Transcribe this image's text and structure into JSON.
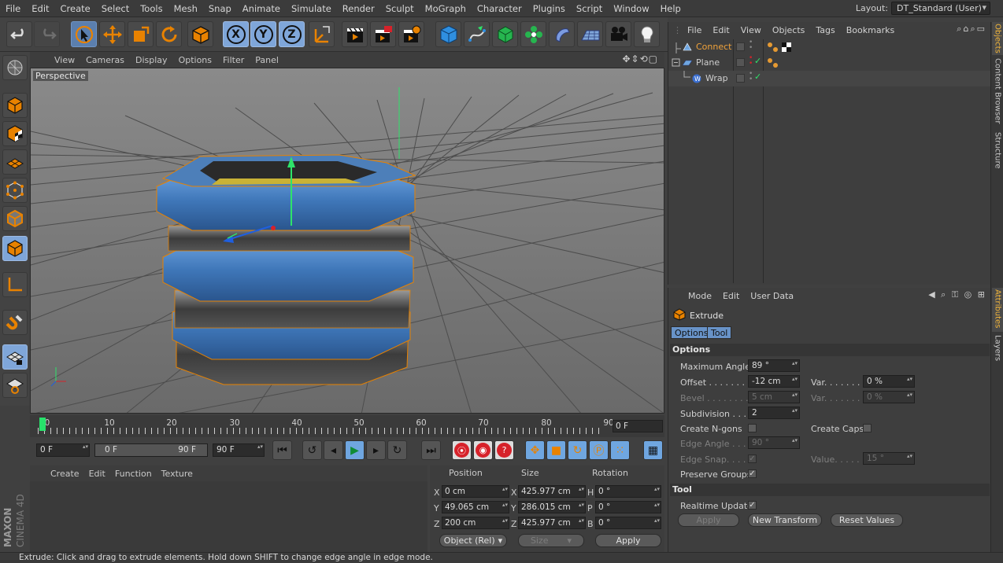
{
  "menubar": {
    "items": [
      "File",
      "Edit",
      "Create",
      "Select",
      "Tools",
      "Mesh",
      "Snap",
      "Animate",
      "Simulate",
      "Render",
      "Sculpt",
      "MoGraph",
      "Character",
      "Plugins",
      "Script",
      "Window",
      "Help"
    ],
    "layout_label": "Layout:",
    "layout_value": "DT_Standard (User)"
  },
  "toolbar": {
    "axis_x": "X",
    "axis_y": "Y",
    "axis_z": "Z"
  },
  "viewport": {
    "menu": [
      "View",
      "Cameras",
      "Display",
      "Options",
      "Filter",
      "Panel"
    ],
    "nav_icons": "✥⇕⟲▢",
    "label": "Perspective"
  },
  "timeline": {
    "ticks": [
      "0",
      "10",
      "20",
      "30",
      "40",
      "50",
      "60",
      "70",
      "80",
      "90"
    ],
    "current_frame": "0 F"
  },
  "playback": {
    "start": "0 F",
    "range_start": "0 F",
    "range_end": "90 F",
    "end": "90 F"
  },
  "material_menu": [
    "Create",
    "Edit",
    "Function",
    "Texture"
  ],
  "coordinates": {
    "headers": {
      "position": "Position",
      "size": "Size",
      "rotation": "Rotation"
    },
    "rows": [
      {
        "axis": "X",
        "pos": "0 cm",
        "size_axis": "X",
        "size": "425.977 cm",
        "rot_axis": "H",
        "rot": "0 °"
      },
      {
        "axis": "Y",
        "pos": "49.065 cm",
        "size_axis": "Y",
        "size": "286.015 cm",
        "rot_axis": "P",
        "rot": "0 °"
      },
      {
        "axis": "Z",
        "pos": "200 cm",
        "size_axis": "Z",
        "size": "425.977 cm",
        "rot_axis": "B",
        "rot": "0 °"
      }
    ],
    "mode": "Object (Rel)",
    "size_mode": "Size",
    "apply": "Apply"
  },
  "objects": {
    "menu": [
      "File",
      "Edit",
      "View",
      "Objects",
      "Tags",
      "Bookmarks"
    ],
    "icons": "⌕⌂⌕▭",
    "items": [
      {
        "name": "Connect",
        "active": true
      },
      {
        "name": "Plane",
        "active": false
      },
      {
        "name": "Wrap",
        "active": false
      }
    ]
  },
  "attributes": {
    "menu": [
      "Mode",
      "Edit",
      "User Data"
    ],
    "icons": "◀ ⌕ ⚿ ◎ ⊞",
    "title": "Extrude",
    "tabs": [
      "Options",
      "Tool"
    ],
    "section_options": "Options",
    "section_tool": "Tool",
    "fields": {
      "max_angle_label": "Maximum Angle",
      "max_angle": "89 °",
      "offset_label": "Offset . . . . . . . .",
      "offset": "-12 cm",
      "offset_var_label": "Var. . . . . . . . .",
      "offset_var": "0 %",
      "bevel_label": "Bevel . . . . . . . .",
      "bevel": "5 cm",
      "bevel_var_label": "Var. . . . . . . . .",
      "bevel_var": "0 %",
      "subdiv_label": "Subdivision . . . .",
      "subdiv": "2",
      "ngons_label": "Create N-gons",
      "caps_label": "Create Caps",
      "edge_angle_label": "Edge Angle . . . .",
      "edge_angle": "90 °",
      "edge_snap_label": "Edge Snap. . . . .",
      "edge_value_label": "Value. . . . . . . .",
      "edge_value": "15 °",
      "preserve_label": "Preserve Groups",
      "realtime_label": "Realtime Update"
    },
    "buttons": {
      "apply": "Apply",
      "new_transform": "New Transform",
      "reset_values": "Reset Values"
    }
  },
  "side_tabs": [
    "Objects",
    "Content Browser",
    "Structure",
    "Attributes",
    "Layers"
  ],
  "logo": {
    "brand": "MAXON",
    "product": "CINEMA 4D"
  },
  "status": "Extrude: Click and drag to extrude elements. Hold down SHIFT to change edge angle in edge mode."
}
